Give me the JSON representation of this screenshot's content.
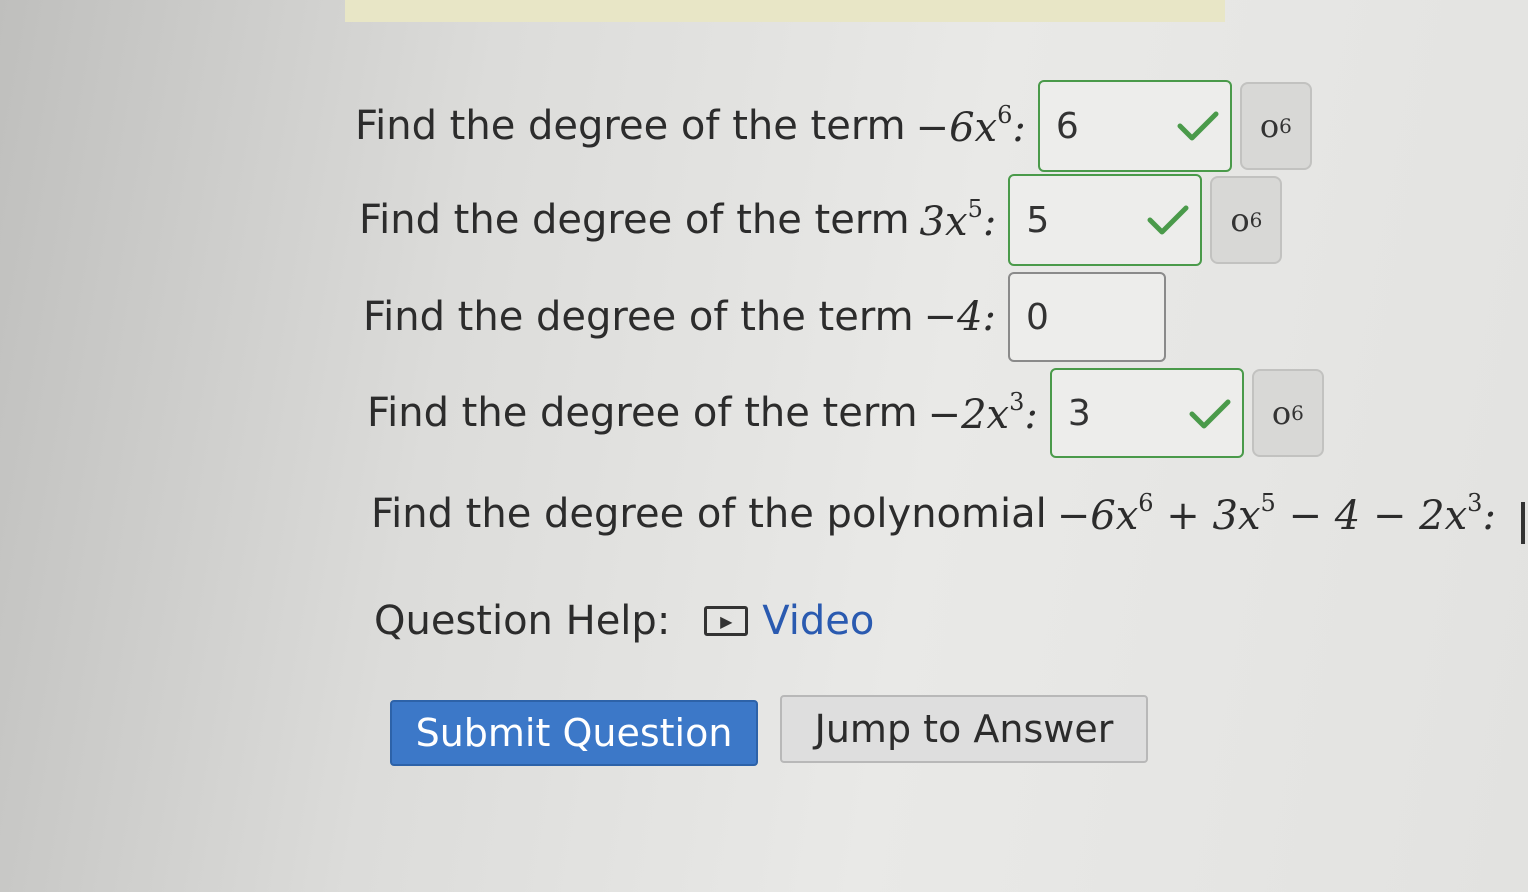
{
  "questions": [
    {
      "prompt": "Find the degree of the term",
      "math": {
        "sign": "−",
        "coef": "6",
        "var": "x",
        "exp": "6"
      },
      "answer": "6",
      "status": "correct",
      "sym_button": {
        "base": "o",
        "sup": "6"
      }
    },
    {
      "prompt": "Find the degree of the term",
      "math": {
        "sign": "",
        "coef": "3",
        "var": "x",
        "exp": "5"
      },
      "answer": "5",
      "status": "correct",
      "sym_button": {
        "base": "o",
        "sup": "6"
      }
    },
    {
      "prompt": "Find the degree of the term",
      "math": {
        "sign": "−",
        "coef": "4",
        "var": "",
        "exp": ""
      },
      "answer": "0",
      "status": "unchecked"
    },
    {
      "prompt": "Find the degree of the term",
      "math": {
        "sign": "−",
        "coef": "2",
        "var": "x",
        "exp": "3"
      },
      "answer": "3",
      "status": "correct",
      "sym_button": {
        "base": "o",
        "sup": "6"
      }
    }
  ],
  "polynomial_question": {
    "prompt": "Find the degree of the polynomial",
    "math": {
      "t1": "−6",
      "v1": "x",
      "e1": "6",
      "op1": " + ",
      "t2": "3",
      "v2": "x",
      "e2": "5",
      "op2": " − 4 − ",
      "t3": "2",
      "v3": "x",
      "e3": "3"
    }
  },
  "help": {
    "label": "Question Help:",
    "video_label": "Video"
  },
  "buttons": {
    "submit": "Submit Question",
    "jump": "Jump to Answer"
  },
  "colors": {
    "primary": "#3c78c8",
    "link": "#2a5ab0",
    "correct": "#4a9a4a"
  }
}
